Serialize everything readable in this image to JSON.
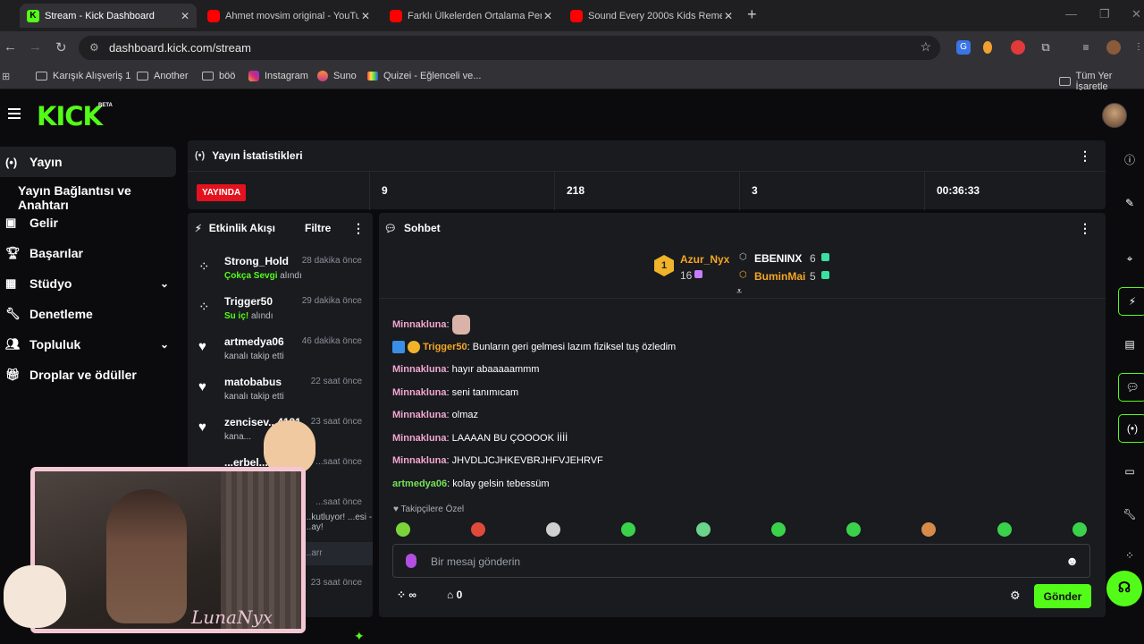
{
  "browser": {
    "tabs": [
      {
        "title": "Stream - Kick Dashboard",
        "icon": "kick-favicon"
      },
      {
        "title": "Ahmet movsim original - YouTube",
        "icon": "youtube-favicon"
      },
      {
        "title": "Farklı Ülkelerden Ortalama Peni",
        "icon": "youtube-favicon"
      },
      {
        "title": "Sound Every 2000s Kids Remem",
        "icon": "youtube-favicon"
      }
    ],
    "url": "dashboard.kick.com/stream",
    "bookmarks": [
      "Karışık Alışveriş 1",
      "Another",
      "böö",
      "Instagram",
      "Suno",
      "Quizei - Eğlenceli ve..."
    ],
    "bookmarks_right": "Tüm Yer İşaretle"
  },
  "kick": {
    "logo": "KICK",
    "beta": "BETA"
  },
  "sidebar": {
    "items": [
      {
        "label": "Yayın",
        "icon": "broadcast-icon"
      },
      {
        "label": "Yayın Bağlantısı ve Anahtarı"
      },
      {
        "label": "Gelir",
        "icon": "wallet-icon"
      },
      {
        "label": "Başarılar",
        "icon": "trophy-icon"
      },
      {
        "label": "Stüdyo",
        "icon": "studio-icon"
      },
      {
        "label": "Denetleme",
        "icon": "wrench-icon"
      },
      {
        "label": "Topluluk",
        "icon": "people-icon"
      },
      {
        "label": "Droplar ve ödüller",
        "icon": "gift-icon"
      }
    ]
  },
  "stats": {
    "title": "Yayın İstatistikleri",
    "live_label": "YAYINDA",
    "values": [
      "9",
      "218",
      "3",
      "00:36:33"
    ]
  },
  "feed": {
    "title": "Etkinlik Akışı",
    "filter_label": "Filtre",
    "items": [
      {
        "name": "Strong_Hold",
        "time": "28 dakika önce",
        "reward": "Çokça Sevgi",
        "desc": "alındı"
      },
      {
        "name": "Trigger50",
        "time": "29 dakika önce",
        "reward": "Su iç!",
        "desc": "alındı"
      },
      {
        "name": "artmedya06",
        "time": "46 dakika önce",
        "desc": "kanalı takip etti"
      },
      {
        "name": "matobabus",
        "time": "22 saat önce",
        "desc": "kanalı takip etti"
      },
      {
        "name": "zencisev...4131",
        "time": "23 saat önce",
        "desc": "kana..."
      },
      {
        "name": "...erbel...",
        "time": "...saat önce",
        "desc": ""
      },
      {
        "name": "",
        "time": "...saat önce",
        "desc": "...kutluyor! ...esi - ...ay!"
      },
      {
        "name": "",
        "time": "...arr",
        "desc": ""
      },
      {
        "name": "",
        "time": "23 saat önce",
        "desc": ""
      }
    ]
  },
  "chat": {
    "title": "Sohbet",
    "leaderboard": {
      "top": {
        "rank": "1",
        "name": "Azur_Nyx",
        "count": "16"
      },
      "second": {
        "name": "EBENINX",
        "count": "6"
      },
      "third": {
        "name": "BuminMai",
        "count": "5"
      }
    },
    "messages": [
      {
        "user": "Minnakluna",
        "text": "",
        "sticker": true
      },
      {
        "user": "Trigger50",
        "text": "Bunların geri gelmesi lazım fiziksel tuş özledim"
      },
      {
        "user": "Minnakluna",
        "text": "hayır abaaaaammm"
      },
      {
        "user": "Minnakluna",
        "text": "seni tanımıcam"
      },
      {
        "user": "Minnakluna",
        "text": "olmaz"
      },
      {
        "user": "Minnakluna",
        "text": "LAAAAN BU ÇOOOOK İİİİ"
      },
      {
        "user": "Minnakluna",
        "text": "JHVDLJCJHKEVBRJHFVJEHRVF"
      },
      {
        "user": "artmedya06",
        "text": "kolay gelsin tebessüm"
      }
    ],
    "followers_label": "Takipçilere Özel",
    "input_placeholder": "Bir mesaj gönderin",
    "points_value": "∞",
    "store_value": "0",
    "send_label": "Gönder"
  },
  "overlay": {
    "name": "LunaNyx"
  }
}
